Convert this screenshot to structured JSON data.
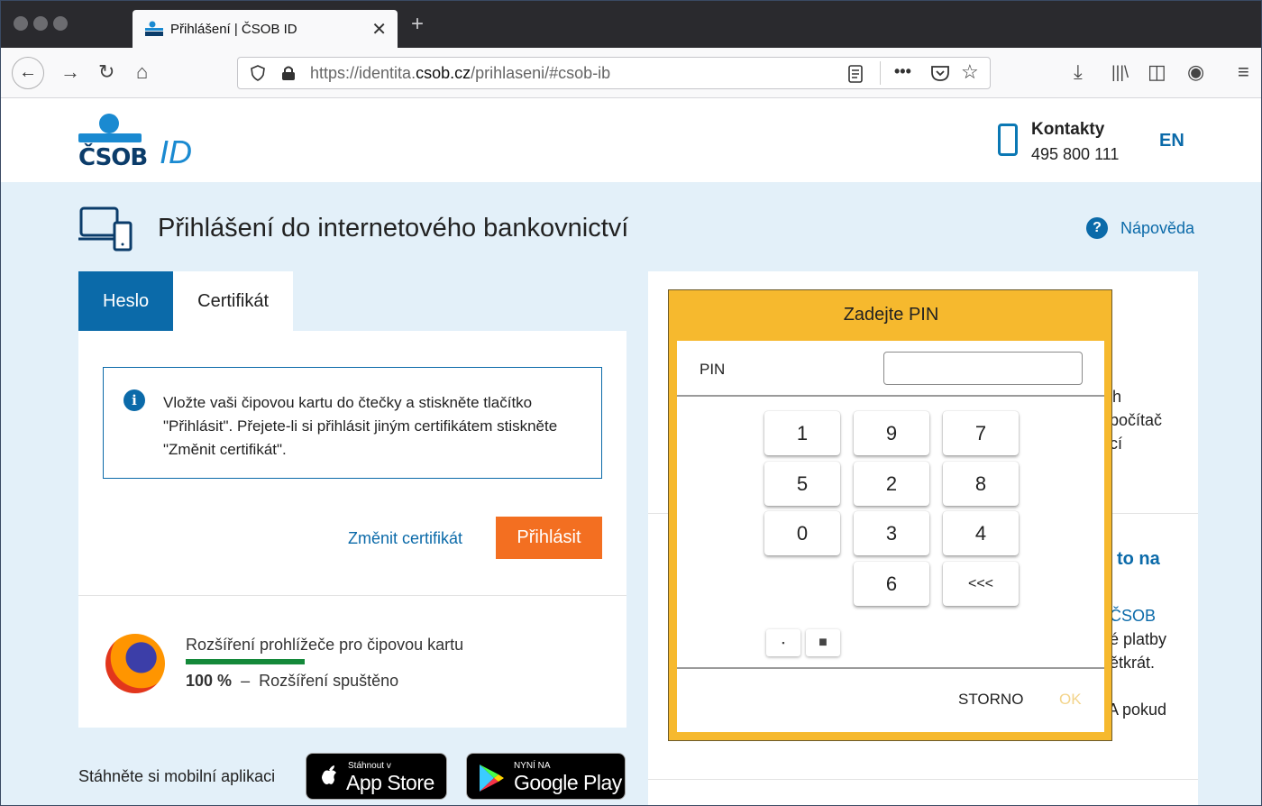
{
  "browser": {
    "tab_title": "Přihlášení | ČSOB ID",
    "tab_close": "✕",
    "new_tab": "+",
    "url_prefix": "https://identita.",
    "url_domain": "csob.cz",
    "url_suffix": "/prihlaseni/#csob-ib"
  },
  "header": {
    "logo_text": "ČSOB",
    "logo_id": "ID",
    "contacts_label": "Kontakty",
    "phone": "495 800 111",
    "language": "EN"
  },
  "page": {
    "title": "Přihlášení do internetového bankovnictví",
    "help": "Nápověda"
  },
  "tabs": [
    {
      "label": "Heslo",
      "active": true
    },
    {
      "label": "Certifikát",
      "active": false
    }
  ],
  "info_text": "Vložte vaši čipovou kartu do čtečky a stiskněte tlačítko \"Přihlásit\". Přejete-li si přihlásit jiným certifikátem stiskněte \"Změnit certifikát\".",
  "actions": {
    "change_cert": "Změnit certifikát",
    "login": "Přihlásit"
  },
  "extension": {
    "title": "Rozšíření prohlížeče pro čipovou kartu",
    "percent": "100 %",
    "dash": "–",
    "status": "Rozšíření spuštěno",
    "progress": 1.0
  },
  "mobile": {
    "label": "Stáhněte si mobilní aplikaci",
    "appstore_small": "Stáhnout v",
    "appstore_big": "App Store",
    "gplay_small": "NYNÍ NA",
    "gplay_big": "Google Play"
  },
  "right_partial": {
    "l1": "h",
    "l2": "počítač",
    "l3": "cí",
    "l4": "to na",
    "l5": "ČSOB",
    "l6": "é platby",
    "l7": "ětkrát.",
    "l8": "A pokud"
  },
  "pin_dialog": {
    "title": "Zadejte PIN",
    "pin_label": "PIN",
    "pin_value": "",
    "keys": [
      "1",
      "9",
      "7",
      "5",
      "2",
      "8",
      "0",
      "3",
      "4",
      "6",
      "<<<"
    ],
    "size_small": "▪",
    "size_big": "■",
    "cancel": "STORNO",
    "ok": "OK"
  },
  "colors": {
    "brand_blue": "#0b6aa9",
    "login_orange": "#f36f21",
    "dialog_yellow": "#f6b92e",
    "progress_green": "#14893a"
  }
}
